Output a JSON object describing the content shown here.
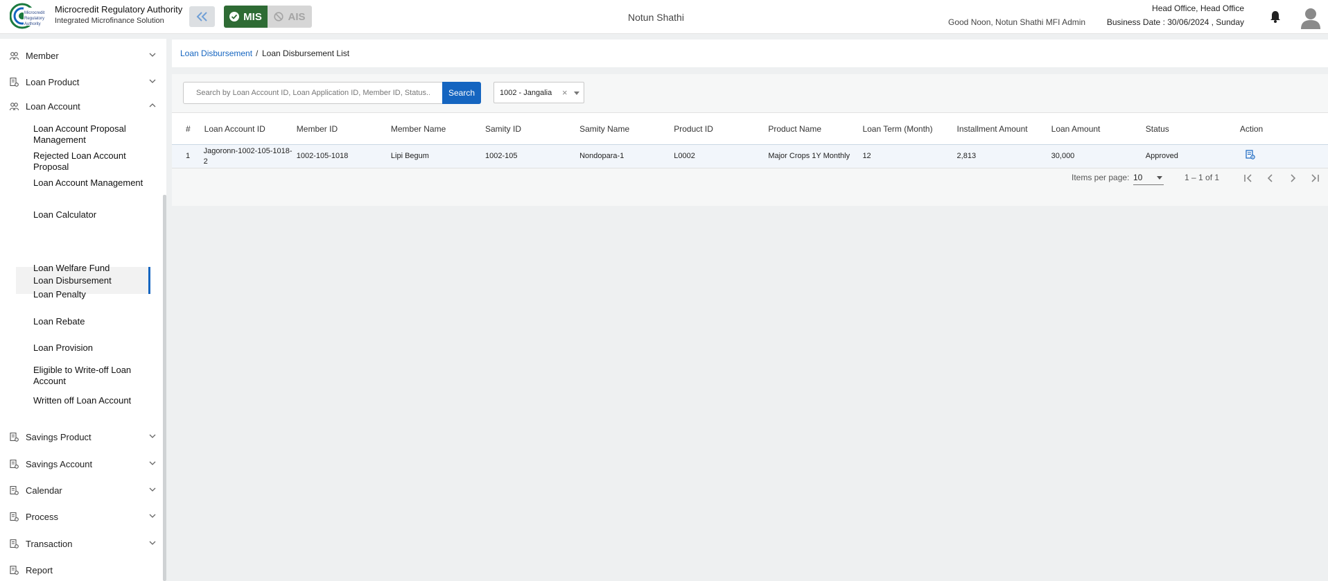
{
  "header": {
    "org_name": "Microcredit Regulatory Authority",
    "org_subtitle": "Integrated Microfinance Solution",
    "logo_text": "Microcredit Regulatory Authority",
    "mis_label": "MIS",
    "ais_label": "AIS",
    "center_title": "Notun Shathi",
    "greeting": "Good Noon, Notun Shathi MFI Admin",
    "office": "Head Office, Head Office",
    "business_date": "Business Date : 30/06/2024 , Sunday",
    "colors": {
      "mis_active": "#2e6b34",
      "accent": "#1565c0"
    }
  },
  "sidebar": {
    "items": [
      {
        "label": "Member",
        "icon": "members-icon",
        "expanded": false
      },
      {
        "label": "Loan Product",
        "icon": "document-icon",
        "expanded": false
      },
      {
        "label": "Loan Account",
        "icon": "members-icon",
        "expanded": true
      },
      {
        "label": "Savings Product",
        "icon": "document-icon",
        "expanded": false
      },
      {
        "label": "Savings Account",
        "icon": "document-icon",
        "expanded": false
      },
      {
        "label": "Calendar",
        "icon": "document-icon",
        "expanded": false
      },
      {
        "label": "Process",
        "icon": "document-icon",
        "expanded": false
      },
      {
        "label": "Transaction",
        "icon": "document-icon",
        "expanded": false
      },
      {
        "label": "Report",
        "icon": "document-icon"
      }
    ],
    "loan_account_sub": [
      "Loan Account Proposal Management",
      "Rejected Loan Account Proposal",
      "Loan Account Management",
      "Loan Calculator",
      "Loan Disbursement",
      "Loan Welfare Fund",
      "Loan Penalty",
      "Loan Rebate",
      "Loan Provision",
      "Eligible to Write-off Loan Account",
      "Written off Loan Account"
    ],
    "active_sub": "Loan Disbursement"
  },
  "breadcrumb": {
    "parent": "Loan Disbursement",
    "separator": "/",
    "current": "Loan Disbursement List"
  },
  "filters": {
    "search_placeholder": "Search by Loan Account ID, Loan Application ID, Member ID, Status...",
    "search_value": "",
    "search_button": "Search",
    "branch_value": "1002 - Jangalia",
    "clear_symbol": "×"
  },
  "table": {
    "columns": [
      "#",
      "Loan Account ID",
      "Member ID",
      "Member Name",
      "Samity ID",
      "Samity Name",
      "Product ID",
      "Product Name",
      "Loan Term (Month)",
      "Installment Amount",
      "Loan Amount",
      "Status",
      "Action"
    ],
    "rows": [
      {
        "index": "1",
        "loan_account_id_line1": "Jagoronn-1002-105-1018-",
        "loan_account_id_line2": "2",
        "member_id": "1002-105-1018",
        "member_name": "Lipi Begum",
        "samity_id": "1002-105",
        "samity_name": "Nondopara-1",
        "product_id": "L0002",
        "product_name": "Major Crops 1Y Monthly",
        "loan_term": "12",
        "installment_amount": "2,813",
        "loan_amount": "30,000",
        "status": "Approved",
        "action_icon": "view-details-icon"
      }
    ]
  },
  "pagination": {
    "items_per_page_label": "Items per page:",
    "items_per_page": "10",
    "range": "1 – 1 of 1"
  }
}
